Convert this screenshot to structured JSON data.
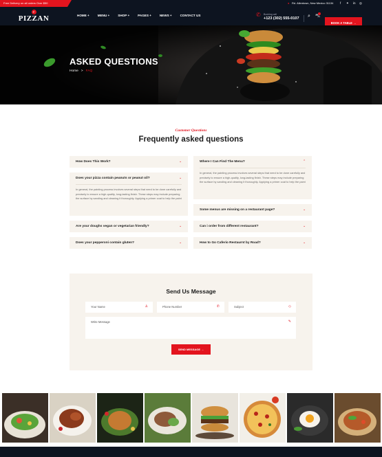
{
  "topbar": {
    "promo": "Free Delivery on all orders Over $50",
    "address": "Rd. Allentown, New Mexico 31134",
    "social_icons": [
      "facebook-icon",
      "twitter-icon",
      "linkedin-icon",
      "instagram-icon"
    ]
  },
  "header": {
    "logo_badge": "P",
    "logo_text": "PIZZAN",
    "nav": [
      "HOME +",
      "MENU +",
      "SHOP +",
      "PAGES +",
      "NEWS +",
      "CONTACT US"
    ],
    "phone_label": "Booking call",
    "phone": "+123 (302) 555-0107",
    "book_label": "BOOK A TABLE →"
  },
  "hero": {
    "title": "ASKED QUESTIONS",
    "crumb_home": "Home",
    "crumb_sep": ">",
    "crumb_current": "FAQ"
  },
  "faq_section": {
    "kicker": "Customer Questions",
    "title": "Frequently asked questions",
    "left": [
      {
        "q": "How Does This Work?",
        "open": false
      },
      {
        "q": "Does your pizza contain peanuts or peanut oil?",
        "open": true,
        "a": "In general, the painting process involves several steps that need to be done carefully and precisely to ensure a high-quality, long-lasting finish. These steps may include preparing the surface by sanding and cleaning it thoroughly. Applying a primer coat to help the paint"
      },
      {
        "q": "Are your doughs vegan or vegetarian friendly?",
        "open": false
      },
      {
        "q": "Does your pepperoni contain gluten?",
        "open": false
      }
    ],
    "right": [
      {
        "q": "Where I Can Find The Menu?",
        "open": true,
        "a": "In general, the painting process involves several steps that need to be done carefully and precisely to ensure a high-quality, long-lasting finish. These steps may include preparing the surface by sanding and cleaning it thoroughly. Applying a primer coat to help the paint"
      },
      {
        "q": "Some menus are missing on a restaurant page?",
        "open": false
      },
      {
        "q": "Can i order from different restaurant?",
        "open": false
      },
      {
        "q": "How to Go Caferio Restaurnt by Road?",
        "open": false
      }
    ]
  },
  "contact_form": {
    "title": "Send Us Message",
    "name_placeholder": "Your Name",
    "phone_placeholder": "Phone Number",
    "subject_placeholder": "Subject",
    "message_placeholder": "Write Message",
    "submit_label": "SEND MESSAGE →"
  },
  "gallery": [
    "salad-image",
    "roast-chicken-image",
    "roast-turkey-image",
    "sliced-meat-image",
    "burger-image",
    "pizza-image",
    "fried-egg-image",
    "noodle-bowl-image"
  ],
  "colors": {
    "accent": "#e3141e",
    "dark": "#0d1420",
    "cream": "#f7f3ed"
  }
}
